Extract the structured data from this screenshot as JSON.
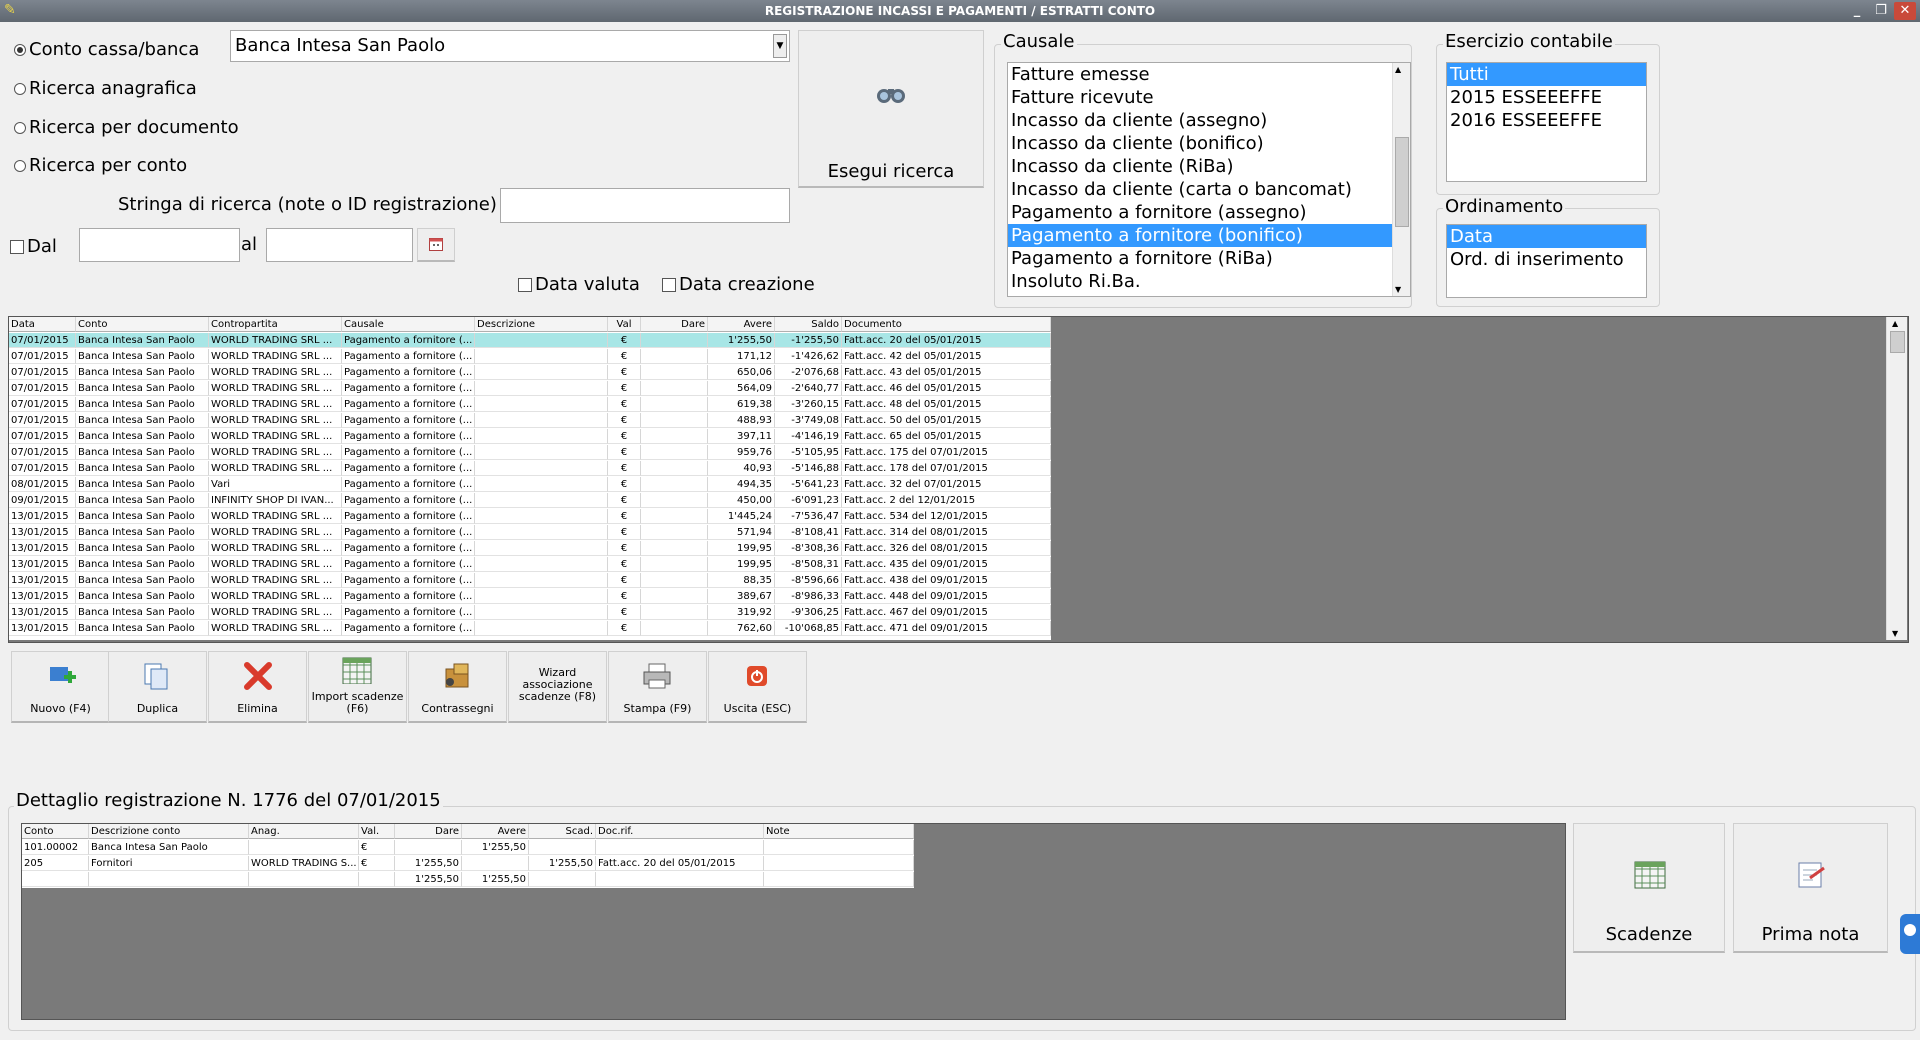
{
  "window": {
    "title": "REGISTRAZIONE INCASSI E PAGAMENTI / ESTRATTI CONTO"
  },
  "search": {
    "radios": [
      "Conto cassa/banca",
      "Ricerca anagrafica",
      "Ricerca per documento",
      "Ricerca per conto"
    ],
    "selected_radio": 0,
    "account_value": "Banca Intesa San Paolo",
    "search_string_label": "Stringa di ricerca (note o ID registrazione) :",
    "search_string_value": "",
    "from_label": "Dal",
    "to_label": "al",
    "from_value": "",
    "to_value": "",
    "value_date_label": "Data valuta",
    "creation_date_label": "Data creazione",
    "run_label": "Esegui ricerca"
  },
  "causale": {
    "title": "Causale",
    "items": [
      "Fatture emesse",
      "Fatture ricevute",
      "Incasso da cliente (assegno)",
      "Incasso da cliente (bonifico)",
      "Incasso da cliente (RiBa)",
      "Incasso da cliente (carta o bancomat)",
      "Pagamento a fornitore (assegno)",
      "Pagamento a fornitore (bonifico)",
      "Pagamento a fornitore (RiBa)",
      "Insoluto Ri.Ba."
    ],
    "selected": 7
  },
  "esercizio": {
    "title": "Esercizio contabile",
    "items": [
      "Tutti",
      "2015 ESSEEEFFE",
      "2016 ESSEEEFFE"
    ],
    "selected": 0
  },
  "ordinamento": {
    "title": "Ordinamento",
    "items": [
      "Data",
      "Ord. di inserimento"
    ],
    "selected": 0
  },
  "main_grid": {
    "columns": [
      "Data",
      "Conto",
      "Contropartita",
      "Causale",
      "Descrizione",
      "Val",
      "Dare",
      "Avere",
      "Saldo",
      "Documento"
    ],
    "rows": [
      [
        "07/01/2015",
        "Banca Intesa San Paolo",
        "WORLD TRADING SRL ...",
        "Pagamento a fornitore (...",
        "",
        "€",
        "",
        "1'255,50",
        "-1'255,50",
        "Fatt.acc. 20 del 05/01/2015"
      ],
      [
        "07/01/2015",
        "Banca Intesa San Paolo",
        "WORLD TRADING SRL ...",
        "Pagamento a fornitore (...",
        "",
        "€",
        "",
        "171,12",
        "-1'426,62",
        "Fatt.acc. 42 del 05/01/2015"
      ],
      [
        "07/01/2015",
        "Banca Intesa San Paolo",
        "WORLD TRADING SRL ...",
        "Pagamento a fornitore (...",
        "",
        "€",
        "",
        "650,06",
        "-2'076,68",
        "Fatt.acc. 43 del 05/01/2015"
      ],
      [
        "07/01/2015",
        "Banca Intesa San Paolo",
        "WORLD TRADING SRL ...",
        "Pagamento a fornitore (...",
        "",
        "€",
        "",
        "564,09",
        "-2'640,77",
        "Fatt.acc. 46 del 05/01/2015"
      ],
      [
        "07/01/2015",
        "Banca Intesa San Paolo",
        "WORLD TRADING SRL ...",
        "Pagamento a fornitore (...",
        "",
        "€",
        "",
        "619,38",
        "-3'260,15",
        "Fatt.acc. 48 del 05/01/2015"
      ],
      [
        "07/01/2015",
        "Banca Intesa San Paolo",
        "WORLD TRADING SRL ...",
        "Pagamento a fornitore (...",
        "",
        "€",
        "",
        "488,93",
        "-3'749,08",
        "Fatt.acc. 50 del 05/01/2015"
      ],
      [
        "07/01/2015",
        "Banca Intesa San Paolo",
        "WORLD TRADING SRL ...",
        "Pagamento a fornitore (...",
        "",
        "€",
        "",
        "397,11",
        "-4'146,19",
        "Fatt.acc. 65 del 05/01/2015"
      ],
      [
        "07/01/2015",
        "Banca Intesa San Paolo",
        "WORLD TRADING SRL ...",
        "Pagamento a fornitore (...",
        "",
        "€",
        "",
        "959,76",
        "-5'105,95",
        "Fatt.acc. 175 del 07/01/2015"
      ],
      [
        "07/01/2015",
        "Banca Intesa San Paolo",
        "WORLD TRADING SRL ...",
        "Pagamento a fornitore (...",
        "",
        "€",
        "",
        "40,93",
        "-5'146,88",
        "Fatt.acc. 178 del 07/01/2015"
      ],
      [
        "08/01/2015",
        "Banca Intesa San Paolo",
        "Vari",
        "Pagamento a fornitore (...",
        "",
        "€",
        "",
        "494,35",
        "-5'641,23",
        "Fatt.acc. 32 del 07/01/2015"
      ],
      [
        "09/01/2015",
        "Banca Intesa San Paolo",
        "INFINITY SHOP DI IVAN...",
        "Pagamento a fornitore (...",
        "",
        "€",
        "",
        "450,00",
        "-6'091,23",
        "Fatt.acc. 2 del 12/01/2015"
      ],
      [
        "13/01/2015",
        "Banca Intesa San Paolo",
        "WORLD TRADING SRL ...",
        "Pagamento a fornitore (...",
        "",
        "€",
        "",
        "1'445,24",
        "-7'536,47",
        "Fatt.acc. 534 del 12/01/2015"
      ],
      [
        "13/01/2015",
        "Banca Intesa San Paolo",
        "WORLD TRADING SRL ...",
        "Pagamento a fornitore (...",
        "",
        "€",
        "",
        "571,94",
        "-8'108,41",
        "Fatt.acc. 314 del 08/01/2015"
      ],
      [
        "13/01/2015",
        "Banca Intesa San Paolo",
        "WORLD TRADING SRL ...",
        "Pagamento a fornitore (...",
        "",
        "€",
        "",
        "199,95",
        "-8'308,36",
        "Fatt.acc. 326 del 08/01/2015"
      ],
      [
        "13/01/2015",
        "Banca Intesa San Paolo",
        "WORLD TRADING SRL ...",
        "Pagamento a fornitore (...",
        "",
        "€",
        "",
        "199,95",
        "-8'508,31",
        "Fatt.acc. 435 del 09/01/2015"
      ],
      [
        "13/01/2015",
        "Banca Intesa San Paolo",
        "WORLD TRADING SRL ...",
        "Pagamento a fornitore (...",
        "",
        "€",
        "",
        "88,35",
        "-8'596,66",
        "Fatt.acc. 438 del 09/01/2015"
      ],
      [
        "13/01/2015",
        "Banca Intesa San Paolo",
        "WORLD TRADING SRL ...",
        "Pagamento a fornitore (...",
        "",
        "€",
        "",
        "389,67",
        "-8'986,33",
        "Fatt.acc. 448 del 09/01/2015"
      ],
      [
        "13/01/2015",
        "Banca Intesa San Paolo",
        "WORLD TRADING SRL ...",
        "Pagamento a fornitore (...",
        "",
        "€",
        "",
        "319,92",
        "-9'306,25",
        "Fatt.acc. 467 del 09/01/2015"
      ],
      [
        "13/01/2015",
        "Banca Intesa San Paolo",
        "WORLD TRADING SRL ...",
        "Pagamento a fornitore (...",
        "",
        "€",
        "",
        "762,60",
        "-10'068,85",
        "Fatt.acc. 471 del 09/01/2015"
      ]
    ],
    "selected_row": 0
  },
  "toolbar": {
    "buttons": [
      {
        "label": "Nuovo (F4)",
        "icon": "add-icon"
      },
      {
        "label": "Duplica",
        "icon": "duplicate-icon"
      },
      {
        "label": "Elimina",
        "icon": "delete-icon"
      },
      {
        "label": "Import scadenze (F6)",
        "icon": "import-icon"
      },
      {
        "label": "Contrassegni",
        "icon": "package-icon"
      },
      {
        "label": "Wizard associazione scadenze (F8)",
        "icon": ""
      },
      {
        "label": "Stampa (F9)",
        "icon": "printer-icon"
      },
      {
        "label": "Uscita (ESC)",
        "icon": "exit-icon"
      }
    ]
  },
  "detail": {
    "title": "Dettaglio registrazione N. 1776 del 07/01/2015",
    "columns": [
      "Conto",
      "Descrizione conto",
      "Anag.",
      "Val.",
      "Dare",
      "Avere",
      "Scad.",
      "Doc.rif.",
      "Note"
    ],
    "rows": [
      [
        "101.00002",
        "Banca Intesa San Paolo",
        "",
        "€",
        "",
        "1'255,50",
        "",
        "",
        ""
      ],
      [
        "205",
        "Fornitori",
        "WORLD TRADING S...",
        "€",
        "1'255,50",
        "",
        "1'255,50",
        "Fatt.acc. 20 del 05/01/2015",
        ""
      ],
      [
        "",
        "",
        "",
        "",
        "1'255,50",
        "1'255,50",
        "",
        "",
        ""
      ]
    ],
    "scadenze_label": "Scadenze",
    "prima_nota_label": "Prima nota"
  },
  "colors": {
    "accent": "#3399ff",
    "selected_row": "#a8e6e6",
    "title_bar": "#6b737c"
  }
}
